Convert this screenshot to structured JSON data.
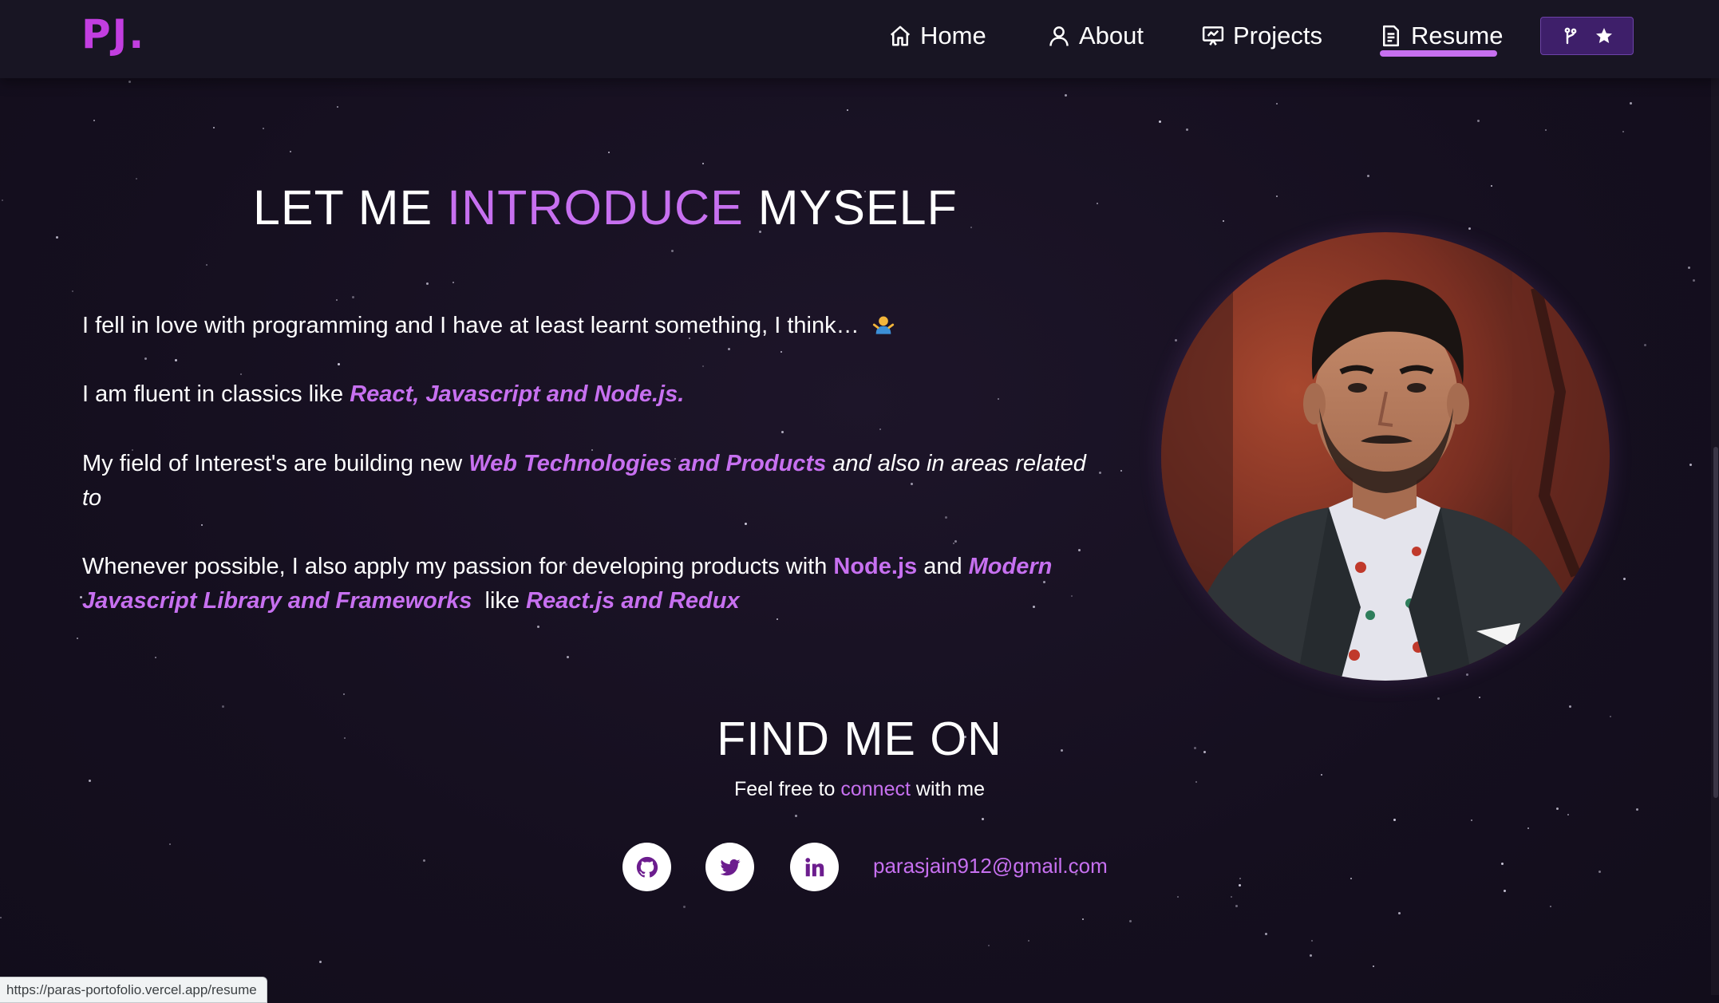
{
  "brand": {
    "logo": "PJ",
    "dot": "."
  },
  "nav": {
    "home": "Home",
    "about": "About",
    "projects": "Projects",
    "resume": "Resume"
  },
  "about": {
    "heading_part1": "LET ME ",
    "heading_accent": "INTRODUCE",
    "heading_part2": " MYSELF",
    "p1": "I fell in love with programming and I have at least learnt something, I think…",
    "p2_text": "I am fluent in classics like ",
    "p2_accent": "React, Javascript and Node.js.",
    "p3_text": "My field of Interest's are building new ",
    "p3_accent": "Web Technologies and Products",
    "p3_italic": " and also in areas related to",
    "p4_text1": "Whenever possible, I also apply my passion for developing products with ",
    "p4_accent1": "Node.js",
    "p4_text2": " and ",
    "p4_accent2": "Modern Javascript Library and Frameworks",
    "p4_text3": "  like ",
    "p4_accent3": "React.js and Redux"
  },
  "find": {
    "heading": "FIND ME ON",
    "sub_before": "Feel free to ",
    "sub_link": "connect",
    "sub_after": " with me",
    "email": "parasjain912@gmail.com"
  },
  "status_url": "https://paras-portofolio.vercel.app/resume",
  "colors": {
    "accent": "#c770f0",
    "logo": "#c23ee0",
    "background": "#17121f",
    "nav": "#181523"
  },
  "icons": [
    "home-icon",
    "user-icon",
    "projects-icon",
    "resume-icon",
    "fork-icon",
    "star-icon",
    "github-icon",
    "twitter-icon",
    "linkedin-icon",
    "shrug-emoji"
  ]
}
